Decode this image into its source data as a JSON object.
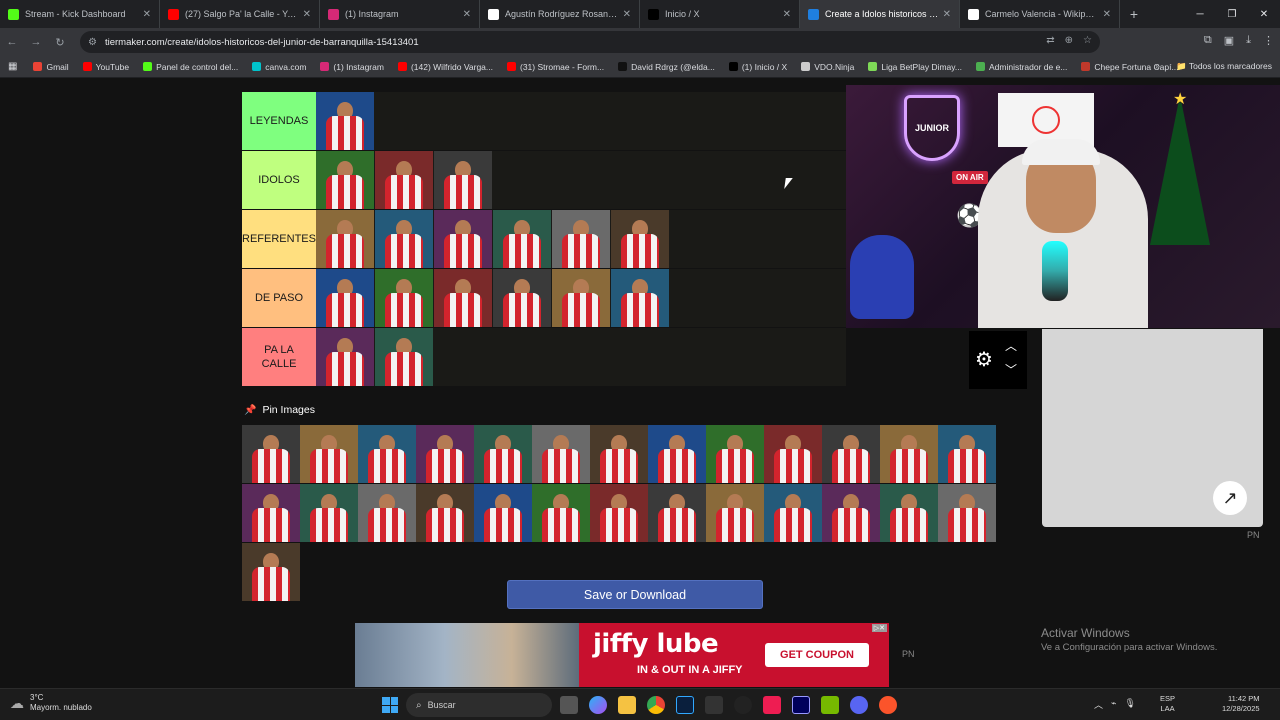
{
  "browser": {
    "tabs": [
      {
        "title": "Stream - Kick Dashboard",
        "color": "#53fc18",
        "active": false
      },
      {
        "title": "(27) Salgo Pa' la Calle - YouTub",
        "color": "#ff0000",
        "active": false
      },
      {
        "title": "(1) Instagram",
        "color": "#d62976",
        "active": false
      },
      {
        "title": "Agustín Rodríguez Rosano - W",
        "color": "#ffffff",
        "active": false
      },
      {
        "title": "Inicio / X",
        "color": "#000000",
        "active": false
      },
      {
        "title": "Create a Idolos historicos del ju",
        "color": "#1f7fe0",
        "active": true
      },
      {
        "title": "Carmelo Valencia - Wikipedia, l",
        "color": "#ffffff",
        "active": false
      }
    ],
    "url": "tiermaker.com/create/idolos-historicos-del-junior-de-barranquilla-15413401",
    "bookmarks": [
      {
        "label": "Gmail",
        "color": "#ea4335"
      },
      {
        "label": "YouTube",
        "color": "#ff0000"
      },
      {
        "label": "Panel de control del...",
        "color": "#53fc18"
      },
      {
        "label": "canva.com",
        "color": "#00c4cc"
      },
      {
        "label": "(1) Instagram",
        "color": "#d62976"
      },
      {
        "label": "(142) Wilfrido Varga...",
        "color": "#ff0000"
      },
      {
        "label": "(31) Stromae - Form...",
        "color": "#ff0000"
      },
      {
        "label": "David Rdrgz (@elda...",
        "color": "#111111"
      },
      {
        "label": "(1) Inicio / X",
        "color": "#000000"
      },
      {
        "label": "VDO.Ninja",
        "color": "#cccccc"
      },
      {
        "label": "Liga BetPlay Dimay...",
        "color": "#7ed957"
      },
      {
        "label": "Administrador de e...",
        "color": "#4caf50"
      },
      {
        "label": "Chepe Fortuna Capí...",
        "color": "#c0392b"
      }
    ],
    "all_bookmarks": "Todos los marcadores"
  },
  "tiers": [
    {
      "label": "LEYENDAS",
      "color": "#7fff7f",
      "count": 1
    },
    {
      "label": "IDOLOS",
      "color": "#bfff7f",
      "count": 3
    },
    {
      "label": "REFERENTES",
      "color": "#ffdf7f",
      "count": 6
    },
    {
      "label": "DE PASO",
      "color": "#ffbf7f",
      "count": 6
    },
    {
      "label": "PA LA CALLE",
      "color": "#ff7f7f",
      "count": 2
    }
  ],
  "pin_title": "Pin Images",
  "pool_count": 27,
  "save_button": "Save or Download",
  "webcam": {
    "neon_text": "JUNIOR",
    "on_air": "ON AIR"
  },
  "pn_label": "PN",
  "ad": {
    "brand": "jiffy lube",
    "tagline": "IN & OUT IN A JIFFY",
    "cta": "GET COUPON"
  },
  "activate_windows": {
    "title": "Activar Windows",
    "subtitle": "Ve a Configuración para activar Windows."
  },
  "taskbar": {
    "weather_temp": "3°C",
    "weather_desc": "Mayorm. nublado",
    "search": "Buscar",
    "lang_1": "ESP",
    "lang_2": "LAA",
    "time": "11:42 PM",
    "date": "12/28/2025"
  }
}
